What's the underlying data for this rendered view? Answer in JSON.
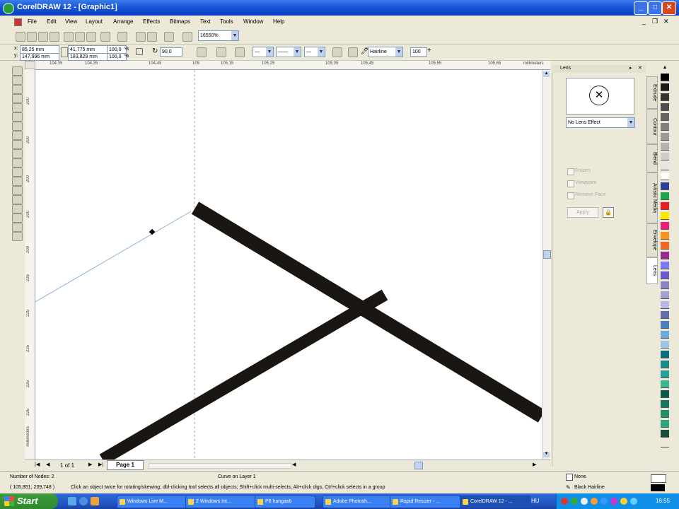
{
  "window": {
    "title": "CorelDRAW 12 - [Graphic1]"
  },
  "menus": [
    "File",
    "Edit",
    "View",
    "Layout",
    "Arrange",
    "Effects",
    "Bitmaps",
    "Text",
    "Tools",
    "Window",
    "Help"
  ],
  "standard_toolbar": {
    "zoom_level": "16550%"
  },
  "property_bar": {
    "x": "85,25 mm",
    "y": "147,996 mm",
    "width": "41,775 mm",
    "height": "183,829 mm",
    "scale_x": "100,0",
    "scale_y": "100,0",
    "scale_unit": "%",
    "angle": "90,0",
    "outline_width": "Hairline",
    "smoothing": "100"
  },
  "rulers": {
    "horizontal_labels": [
      "104,35",
      "104,35",
      "104,45",
      "105",
      "105,15",
      "105,25",
      "105,35",
      "105,45",
      "105,55",
      "105,65",
      "millimeters"
    ],
    "vertical_labels": [
      "200",
      "200",
      "200",
      "200",
      "200",
      "225",
      "225",
      "225",
      "225",
      "225",
      "millimeters"
    ]
  },
  "lens_docker": {
    "title": "Lens",
    "effect": "No Lens Effect",
    "options": [
      "Frozen",
      "Viewpoint",
      "Remove Face"
    ],
    "apply_label": "Apply"
  },
  "docker_tabs": [
    "Extrude",
    "Contour",
    "Blend",
    "Artistic Media",
    "Envelope",
    "Lens"
  ],
  "page_nav": {
    "counter": "1 of 1",
    "page_tab": "Page 1"
  },
  "status": {
    "nodes": "Number of Nodes: 2",
    "layer": "Curve on Layer 1",
    "coords": "( 105,851; 239,748 )",
    "hint": "Click an object twice for rotating/skewing; dbl-clicking tool selects all objects; Shift+click multi-selects; Alt+click digs; Ctrl+click selects in a group",
    "fill": "None",
    "outline": "Black  Hairline"
  },
  "taskbar": {
    "start_label": "Start",
    "tasks": [
      "Windows Live M...",
      "2 Windows Int...",
      "P8 hangas6",
      "Adobe Photosh...",
      "Rapid Resizer - ...",
      "CorelDRAW 12 - ..."
    ],
    "lang": "HU",
    "clock": "16:55"
  },
  "colors": {
    "titlebar": "#1552d6",
    "canvas_bg": "#ffffff",
    "stroke": "#1a1712",
    "guide": "#8fb4d8"
  },
  "palette": [
    "#000000",
    "#1a1a1a",
    "#333333",
    "#4d4d4d",
    "#666666",
    "#808080",
    "#999999",
    "#b3b3b3",
    "#cccccc",
    "#e6e6e6",
    "#ffffff",
    "#2b3f9c",
    "#1fa64a",
    "#e51f24",
    "#ffe600",
    "#ed1e79",
    "#f7941d",
    "#f26522",
    "#9b2a8d",
    "#7a7aff",
    "#6a5acd",
    "#8b83c4",
    "#a4a0d6",
    "#bcb7e4",
    "#5f6fb0",
    "#4d7ec1",
    "#6fa8dc",
    "#9fc5e8",
    "#0e6c82",
    "#1c8b8b",
    "#2aa198",
    "#3fb58f",
    "#0b5c49",
    "#17765b",
    "#22906d",
    "#2da57e",
    "#1d4e3a",
    "#00000000"
  ]
}
